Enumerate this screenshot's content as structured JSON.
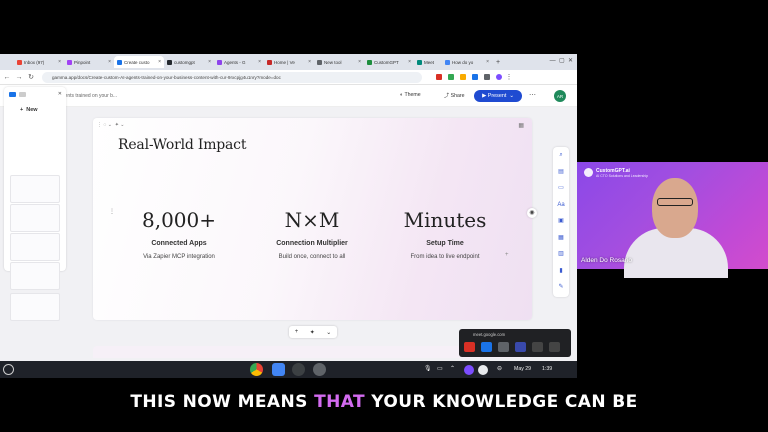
{
  "browser": {
    "tabs": [
      {
        "label": "Inbox (97)",
        "color": "#ea4335"
      },
      {
        "label": "Pinpoint",
        "color": "#a142f4"
      },
      {
        "label": "Create custo",
        "color": "#1a73e8",
        "active": true
      },
      {
        "label": "customgpt",
        "color": "#24292f"
      },
      {
        "label": "Agents - G",
        "color": "#8e44ec"
      },
      {
        "label": "Home | Ve",
        "color": "#c62828"
      },
      {
        "label": "New tool",
        "color": "#5f6368"
      },
      {
        "label": "CustomGPT",
        "color": "#1e8e3e"
      },
      {
        "label": "Meet",
        "color": "#00897b"
      },
      {
        "label": "How do yo",
        "color": "#4285f4"
      }
    ],
    "url": "gamma.app/docs/Create-custom-AI-agents-trained-on-your-business-content-with-cur-9rxcpjg4u1nry?mode=doc"
  },
  "app": {
    "doc_title": "Create custom AI agents trained on your b...",
    "theme_label": "Theme",
    "share_label": "Share",
    "present_label": "Present",
    "avatar_initials": "AR",
    "new_label": "New",
    "brand_color": "#1f4bd1"
  },
  "card": {
    "heading": "Real-World Impact",
    "stats": [
      {
        "value": "8,000+",
        "label": "Connected Apps",
        "sub": "Via Zapier MCP integration"
      },
      {
        "value": "N×M",
        "label": "Connection Multiplier",
        "sub": "Build once, connect to all"
      },
      {
        "value": "Minutes",
        "label": "Setup Time",
        "sub": "From idea to live endpoint"
      }
    ]
  },
  "meet": {
    "url": "meet.google.com"
  },
  "taskbar": {
    "date": "May 29",
    "time": "1:39"
  },
  "webcam": {
    "brand": "CustomGPT.ai",
    "brand_sub": "AI CTO Solutions and Leadership",
    "name": "Alden Do Rosario"
  },
  "caption": {
    "before": "THIS NOW MEANS",
    "highlight": "THAT",
    "after": "YOUR KNOWLEDGE CAN BE",
    "highlight_color": "#d36bf0"
  }
}
